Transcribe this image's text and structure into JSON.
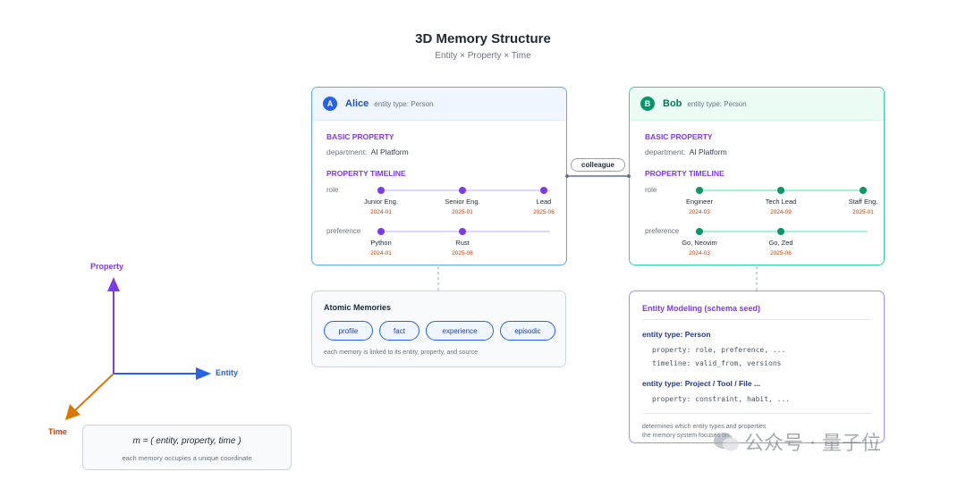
{
  "title": "3D Memory Structure",
  "subtitle": "Entity × Property × Time",
  "axes": {
    "property": "Property",
    "entity": "Entity",
    "time": "Time",
    "formula": "m = ( entity, property, time )",
    "formula_note": "each memory occupies a unique coordinate"
  },
  "alice": {
    "badge": "A",
    "name": "Alice",
    "type": "entity type: Person",
    "basic_heading": "BASIC PROPERTY",
    "dept_key": "department:",
    "dept_val": "AI Platform",
    "timeline_heading": "PROPERTY TIMELINE",
    "role_label": "role",
    "roles": [
      {
        "label": "Junior Eng.",
        "date": "2024-01"
      },
      {
        "label": "Senior Eng.",
        "date": "2025-01"
      },
      {
        "label": "Lead",
        "date": "2025-06"
      }
    ],
    "pref_label": "preference",
    "prefs": [
      {
        "label": "Python",
        "date": "2024-01"
      },
      {
        "label": "Rust",
        "date": "2025-06"
      }
    ]
  },
  "bob": {
    "badge": "B",
    "name": "Bob",
    "type": "entity type: Person",
    "basic_heading": "BASIC PROPERTY",
    "dept_key": "department:",
    "dept_val": "AI Platform",
    "timeline_heading": "PROPERTY TIMELINE",
    "role_label": "role",
    "roles": [
      {
        "label": "Engineer",
        "date": "2024-03"
      },
      {
        "label": "Tech Lead",
        "date": "2024-09"
      },
      {
        "label": "Staff Eng.",
        "date": "2025-01"
      }
    ],
    "pref_label": "preference",
    "prefs": [
      {
        "label": "Go, Neovim",
        "date": "2024-03"
      },
      {
        "label": "Go, Zed",
        "date": "2025-06"
      }
    ]
  },
  "relation": "colleague",
  "atomic": {
    "title": "Atomic Memories",
    "pills": [
      "profile",
      "fact",
      "experience",
      "episodic"
    ],
    "note": "each memory is linked to its entity, property, and source"
  },
  "modeling": {
    "title": "Entity Modeling (schema seed)",
    "person_heading": "entity type: Person",
    "person_line1": "property: role, preference, ...",
    "person_line2": "timeline: valid_from, versions",
    "other_heading": "entity type: Project / Tool / File ...",
    "other_line1": "property: constraint, habit, ...",
    "note_line1": "determines which entity types and properties",
    "note_line2": "the memory system focuses on"
  },
  "watermark": "公众号 · 量子位",
  "colors": {
    "alice": "#2563eb",
    "bob": "#059669",
    "purple": "#7c3aed",
    "date": "#c2410c",
    "time_axis": "#d97706"
  }
}
